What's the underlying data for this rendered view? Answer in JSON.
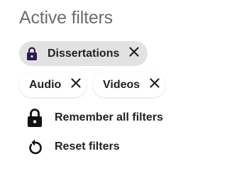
{
  "panel": {
    "title": "Active filters"
  },
  "active_filters": [
    {
      "label": "Dissertations",
      "icon": "lock-icon",
      "icon_color": "#2d1b4e",
      "selected": true
    },
    {
      "label": "Audio",
      "selected": false
    },
    {
      "label": "Videos",
      "selected": false
    }
  ],
  "actions": {
    "remember_label": "Remember all filters",
    "remember_icon": "lock-icon",
    "reset_label": "Reset filters",
    "reset_icon": "reset-icon"
  },
  "colors": {
    "title": "#6e6e6e",
    "text": "#222222",
    "active_chip_bg": "#e2e2e2"
  }
}
